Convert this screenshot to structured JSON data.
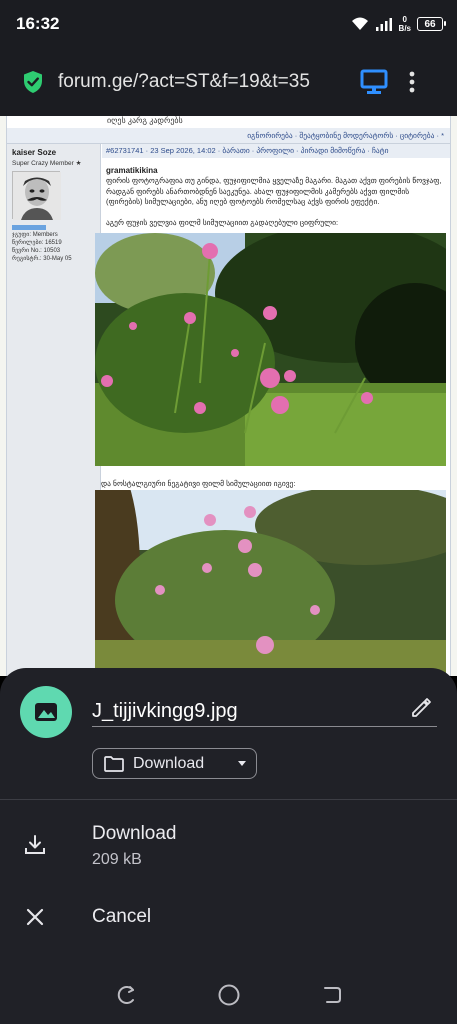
{
  "status": {
    "time": "16:32",
    "net_speed_value": "0",
    "net_speed_unit": "B/s",
    "battery": "66"
  },
  "browser": {
    "url": "forum.ge/?act=ST&f=19&t=35",
    "security_icon": "shield-check-icon",
    "desktop_icon": "desktop-site-icon",
    "menu_icon": "more-vert-icon"
  },
  "forum": {
    "top_snippet": "იღეს კარგ კადრებს",
    "post_actions": "იგნორირება · შეატყობინე მოდერატორს · ციტირება · *",
    "author": "kaiser Soze",
    "rank": "Super Crazy Member ★",
    "group": "ჯგუფი: Members",
    "posts": "წერილები: 16519",
    "member_no": "წევრი No.: 10503",
    "registered": "რეგისტრ.: 30-May 05",
    "post_header": "#62731741 · 23 Sep 2026, 14:02 · ბარათი · პროფილი · პირადი მიმოწერა · ჩატი",
    "quote_author": "gramatikikina",
    "quote_text": "ფირის ფოტოგრაფია თუ გინდა, ფუჯიფილმია ყველაზე მაგარი. მაგათ აქვთ ფირების წოვჯაფ, რადგან ფირებს ანართობდნენ საეკუნეა. ახალ ფუჯიფილმის კამერებს აქვთ ფილმის (ფირების) სიმულაციები, ანუ იღებ ფოტოებს რომელსაც აქვს ფირის ეფექტი.",
    "caption1": "აგერ ფუჯის ველვია ფილმ სიმულაციით გადაღებული ციფრული:",
    "caption2": "და ნოსტალგიური ნეგატივი ფილმ სიმულაციით იგივე:"
  },
  "sheet": {
    "file_icon": "image-icon",
    "file_name": "J_tijjivkingg9.jpg",
    "edit_icon": "pencil-icon",
    "folder_icon": "folder-icon",
    "folder": "Download",
    "download_label": "Download",
    "download_size": "209 kB",
    "cancel_label": "Cancel"
  },
  "navbar": {
    "recents_icon": "recents-icon",
    "home_icon": "home-circle-icon",
    "back_icon": "back-icon"
  },
  "colors": {
    "sheet_bg": "#202127",
    "accent": "#5fd9b0",
    "security": "#2ecc71",
    "desktop_icon": "#2f8fff"
  }
}
